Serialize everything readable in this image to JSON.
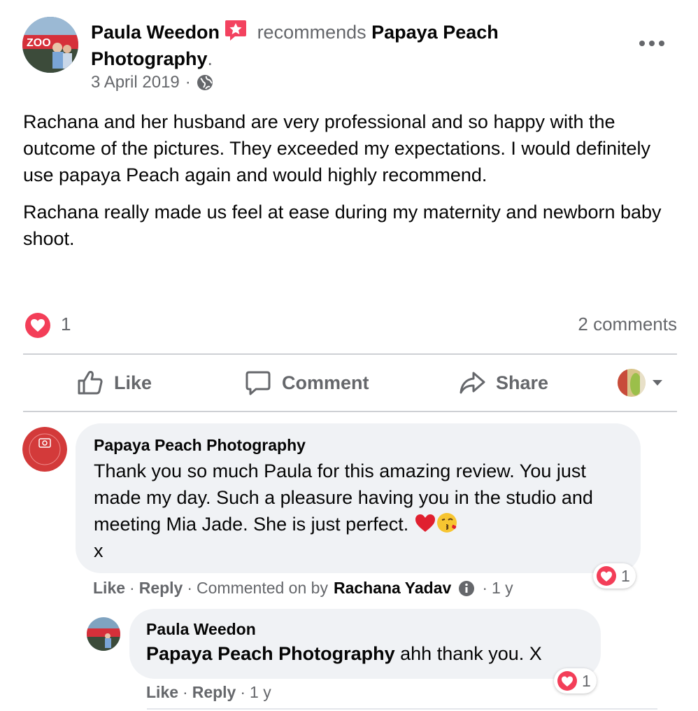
{
  "post": {
    "author": "Paula Weedon",
    "recommends_text": "recommends",
    "page": "Papaya Peach Photography",
    "period": ".",
    "date": "3 April 2019",
    "separator": "·",
    "body": [
      "Rachana and her husband are very professional and so happy with the outcome of the pictures. They exceeded my expectations. I would definitely use papaya Peach again and would highly recommend.",
      "Rachana really made us feel at ease during my maternity and newborn baby shoot."
    ],
    "reaction_count": "1",
    "comments_count": "2 comments"
  },
  "actions": {
    "like": "Like",
    "comment": "Comment",
    "share": "Share"
  },
  "comments": [
    {
      "author": "Papaya Peach Photography",
      "text_line": "Thank you so much Paula for this amazing review. You just made my day. Such a pleasure having you in the studio and meeting Mia Jade. She is just perfect.",
      "text_end": "x",
      "like": "Like",
      "reply": "Reply",
      "commented_on_by": "Commented on by",
      "commenter": "Rachana Yadav",
      "time": "1 y",
      "reactions": "1"
    },
    {
      "author": "Paula Weedon",
      "mention": "Papaya Peach Photography",
      "text": "ahh thank you. X",
      "like": "Like",
      "reply": "Reply",
      "time": "1 y",
      "reactions": "1"
    }
  ],
  "colors": {
    "muted": "#65676b",
    "bubble": "#f0f2f5",
    "heart": "#f33e58",
    "badge": "#f3425f"
  }
}
